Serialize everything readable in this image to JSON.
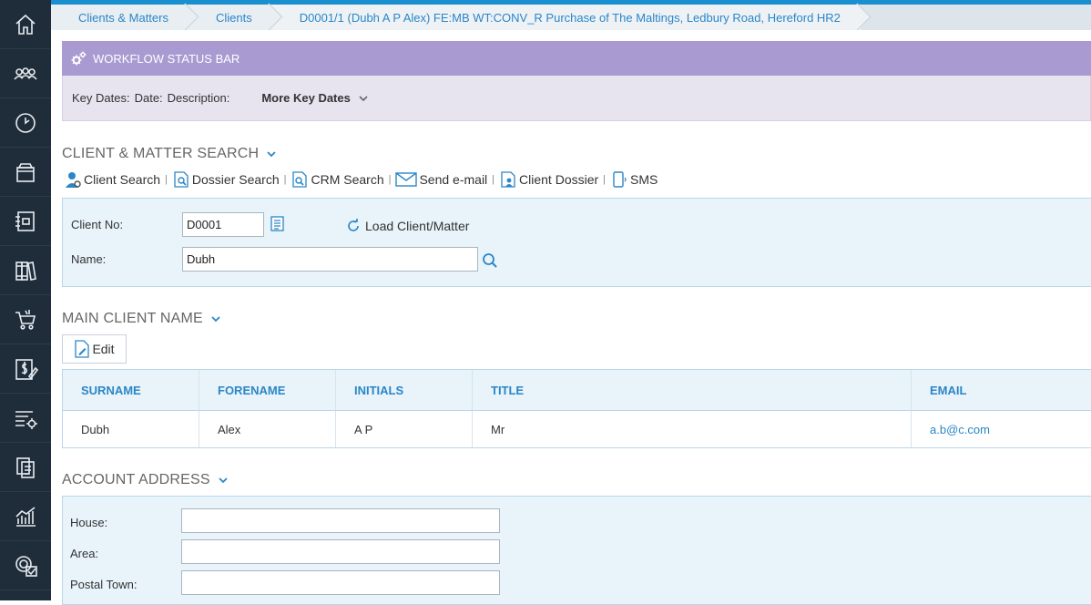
{
  "sidebar": {
    "items": [
      {
        "icon": "home-icon"
      },
      {
        "icon": "people-icon"
      },
      {
        "icon": "clock-icon"
      },
      {
        "icon": "archive-icon"
      },
      {
        "icon": "notebook-icon"
      },
      {
        "icon": "books-icon"
      },
      {
        "icon": "cart-icon"
      },
      {
        "icon": "billing-icon"
      },
      {
        "icon": "list-settings-icon"
      },
      {
        "icon": "documents-icon"
      },
      {
        "icon": "chart-icon"
      },
      {
        "icon": "settings-check-icon"
      }
    ]
  },
  "breadcrumb": {
    "items": [
      "Clients & Matters",
      "Clients",
      "D0001/1 (Dubh A P Alex) FE:MB WT:CONV_R Purchase of The Maltings, Ledbury Road, Hereford HR2"
    ]
  },
  "workflow": {
    "title": "WORKFLOW STATUS BAR",
    "key_dates_label": "Key Dates:",
    "date_label": "Date:",
    "description_label": "Description:",
    "more_label": "More Key Dates"
  },
  "search": {
    "title": "CLIENT & MATTER SEARCH",
    "tools": {
      "client_search": "Client Search",
      "dossier_search": "Dossier Search",
      "crm_search": "CRM Search",
      "send_email": "Send e-mail",
      "client_dossier": "Client Dossier",
      "sms": "SMS"
    },
    "client_no_label": "Client No:",
    "client_no_value": "D0001",
    "load_label": "Load Client/Matter",
    "name_label": "Name:",
    "name_value": "Dubh"
  },
  "main_client": {
    "title": "MAIN CLIENT NAME",
    "edit_label": "Edit",
    "columns": [
      "SURNAME",
      "FORENAME",
      "INITIALS",
      "TITLE",
      "EMAIL"
    ],
    "row": [
      "Dubh",
      "Alex",
      "A P",
      "Mr",
      "a.b@c.com"
    ]
  },
  "address": {
    "title": "ACCOUNT ADDRESS",
    "house_label": "House:",
    "area_label": "Area:",
    "postal_town_label": "Postal Town:",
    "house_value": "",
    "area_value": "",
    "postal_town_value": ""
  },
  "colors": {
    "sidebar": "#1f2d3a",
    "accent": "#2a86c8",
    "workflow_header": "#a99bd1",
    "panel": "#e8f3fa"
  }
}
